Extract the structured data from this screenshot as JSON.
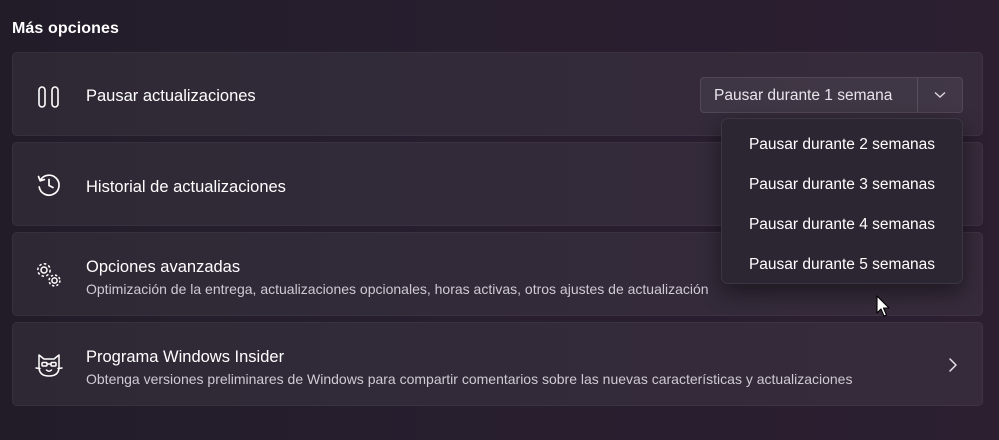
{
  "section": {
    "title": "Más opciones"
  },
  "cards": {
    "pause": {
      "icon": "pause-icon",
      "title": "Pausar actualizaciones",
      "select": {
        "value": "Pausar durante 1 semana",
        "icon": "chevron-down-icon",
        "options": [
          "Pausar durante 2 semanas",
          "Pausar durante 3 semanas",
          "Pausar durante 4 semanas",
          "Pausar durante 5 semanas"
        ]
      }
    },
    "history": {
      "icon": "history-icon",
      "title": "Historial de actualizaciones"
    },
    "advanced": {
      "icon": "gears-icon",
      "title": "Opciones avanzadas",
      "description": "Optimización de la entrega, actualizaciones opcionales, horas activas, otros ajustes de actualización"
    },
    "insider": {
      "icon": "insider-cat-icon",
      "title": "Programa Windows Insider",
      "description": "Obtenga versiones preliminares de Windows para compartir comentarios sobre las nuevas características y actualizaciones",
      "action_icon": "chevron-right-icon"
    }
  },
  "cursor": {
    "icon": "mouse-pointer-icon"
  },
  "colors": {
    "background": "#241d2b",
    "card": "#342d3a",
    "dropdown": "#2c2532",
    "text_primary": "#ffffff",
    "text_secondary": "#cfcad3"
  }
}
